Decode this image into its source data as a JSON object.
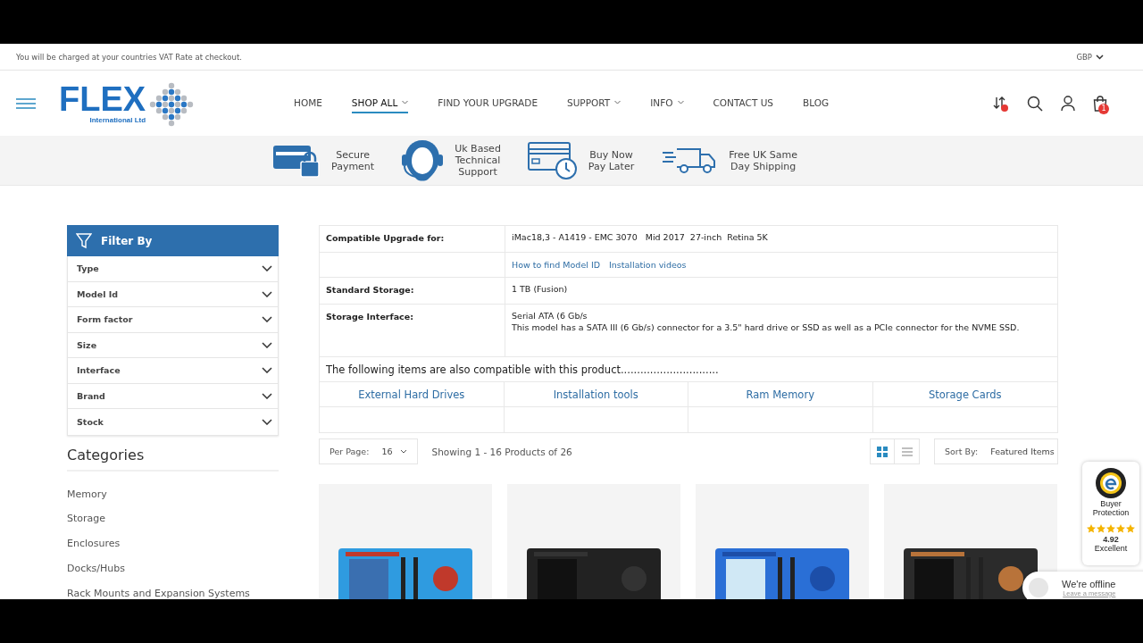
{
  "top_bar": {
    "notice": "You will be charged at your countries VAT Rate at checkout.",
    "currency": "GBP"
  },
  "header": {
    "logo": {
      "name": "FLEX",
      "tagline": "International Ltd"
    },
    "nav": [
      {
        "label": "HOME",
        "selected": false,
        "has_menu": false
      },
      {
        "label": "SHOP ALL",
        "selected": true,
        "has_menu": true
      },
      {
        "label": "FIND YOUR UPGRADE",
        "selected": false,
        "has_menu": false
      },
      {
        "label": "SUPPORT",
        "selected": false,
        "has_menu": true
      },
      {
        "label": "INFO",
        "selected": false,
        "has_menu": true
      },
      {
        "label": "CONTACT US",
        "selected": false,
        "has_menu": false
      },
      {
        "label": "BLOG",
        "selected": false,
        "has_menu": false
      }
    ],
    "cart_count": "1"
  },
  "benefits": [
    {
      "kind": "payment",
      "text": [
        "Secure",
        "Payment"
      ]
    },
    {
      "kind": "support",
      "text": [
        "Uk Based",
        "Technical",
        "Support"
      ]
    },
    {
      "kind": "later",
      "text": [
        "Buy Now",
        "Pay Later"
      ]
    },
    {
      "kind": "shipping",
      "text": [
        "Free UK Same",
        "Day Shipping"
      ]
    }
  ],
  "filter": {
    "title": "Filter By",
    "items": [
      "Type",
      "Model Id",
      "Form factor",
      "Size",
      "Interface",
      "Brand",
      "Stock"
    ]
  },
  "categories": {
    "title": "Categories",
    "items": [
      "Memory",
      "Storage",
      "Enclosures",
      "Docks/Hubs",
      "Rack Mounts and Expansion Systems"
    ]
  },
  "specs": [
    {
      "label": "Compatible Upgrade for:",
      "values": [
        "iMac18,3 - A1419 - EMC 3070   Mid 2017  27-inch  Retina 5K"
      ]
    },
    {
      "links": [
        "How to find Model ID",
        "Installation videos"
      ]
    },
    {
      "label": "Standard Storage:",
      "values": [
        "1 TB (Fusion)"
      ]
    },
    {
      "label": "Storage Interface:",
      "values": [
        "Serial ATA (6 Gb/s",
        "This model has a SATA III (6 Gb/s) connector for a 3.5\" hard drive or SSD as well as a PCIe connector for the NVME SSD."
      ]
    }
  ],
  "also_compatible": {
    "heading": "The following items are also compatible with this product..............................",
    "links": [
      "External Hard Drives",
      "Installation tools",
      "Ram Memory",
      "Storage Cards"
    ]
  },
  "toolbar": {
    "per_page_label": "Per Page:",
    "per_page": "16",
    "showing": "Showing 1 - 16 Products of 26",
    "views": [
      {
        "kind": "grid",
        "selected": true
      },
      {
        "kind": "list",
        "selected": false
      }
    ],
    "sort_label": "Sort By:",
    "sort": "Featured Items"
  },
  "trust_badge": {
    "title": [
      "Buyer",
      "Protection"
    ],
    "stars": 5,
    "rating": "4.92",
    "verdict": "Excellent"
  },
  "chat": {
    "status": "We're offline",
    "link": "Leave a message"
  }
}
